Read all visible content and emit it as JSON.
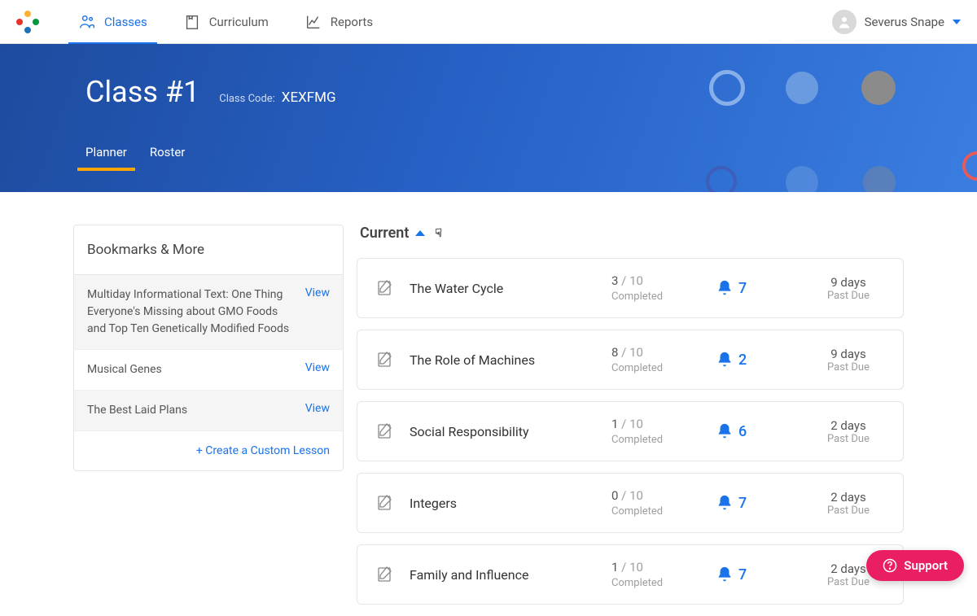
{
  "nav": {
    "classes": "Classes",
    "curriculum": "Curriculum",
    "reports": "Reports"
  },
  "user": {
    "name": "Severus Snape"
  },
  "header": {
    "title": "Class #1",
    "codeLabel": "Class Code:",
    "codeValue": "XEXFMG",
    "tabs": {
      "planner": "Planner",
      "roster": "Roster"
    }
  },
  "bookmarks": {
    "heading": "Bookmarks & More",
    "items": [
      {
        "title": "Multiday Informational Text: One Thing Everyone's Missing about GMO Foods and Top Ten Genetically Modified Foods",
        "view": "View"
      },
      {
        "title": "Musical Genes",
        "view": "View"
      },
      {
        "title": "The Best Laid Plans",
        "view": "View"
      }
    ],
    "createLabel": "+  Create a Custom Lesson"
  },
  "current": {
    "heading": "Current",
    "completedLabel": "Completed",
    "pastDueLabel": "Past Due",
    "lessons": [
      {
        "title": "The Water Cycle",
        "done": "3",
        "total": "10",
        "bell": "7",
        "due": "9 days"
      },
      {
        "title": "The Role of Machines",
        "done": "8",
        "total": "10",
        "bell": "2",
        "due": "9 days"
      },
      {
        "title": "Social Responsibility",
        "done": "1",
        "total": "10",
        "bell": "6",
        "due": "2 days"
      },
      {
        "title": "Integers",
        "done": "0",
        "total": "10",
        "bell": "7",
        "due": "2 days"
      },
      {
        "title": "Family and Influence",
        "done": "1",
        "total": "10",
        "bell": "7",
        "due": "2 days"
      }
    ]
  },
  "support": {
    "label": "Support"
  }
}
